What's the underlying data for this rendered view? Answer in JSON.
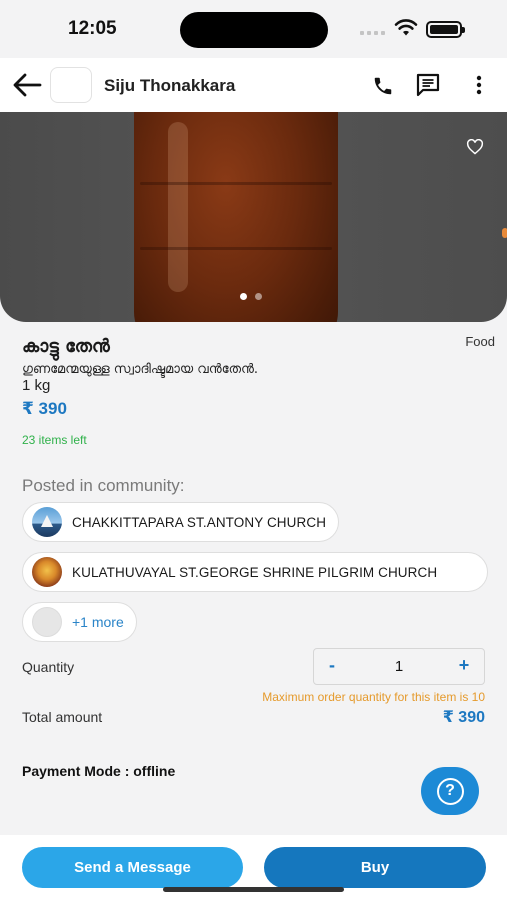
{
  "status_bar": {
    "time": "12:05"
  },
  "header": {
    "title": "Siju Thonakkara"
  },
  "gallery": {
    "image_count": 2,
    "active_index": 0
  },
  "product": {
    "title": "കാട്ടു തേൻ",
    "category": "Food",
    "description": "ഗുണമേന്മയുള്ള സ്വാദിഷ്ടമായ വൻതേൻ.",
    "weight": "1 kg",
    "price": "₹ 390",
    "stock": "23 items left"
  },
  "community": {
    "label": "Posted in community:",
    "items": [
      {
        "name": "CHAKKITTAPARA ST.ANTONY CHURCH"
      },
      {
        "name": "KULATHUVAYAL ST.GEORGE SHRINE PILGRIM CHURCH"
      }
    ],
    "more": "+1 more"
  },
  "order": {
    "quantity_label": "Quantity",
    "minus": "-",
    "quantity": "1",
    "plus": "+",
    "max_note": "Maximum order quantity for this item is 10",
    "total_label": "Total amount",
    "total_value": "₹ 390",
    "payment_mode": "Payment Mode : offline"
  },
  "help": {
    "label": "?"
  },
  "actions": {
    "message": "Send a Message",
    "buy": "Buy"
  },
  "colors": {
    "accent": "#1d78c1",
    "stock_green": "#2fb14a",
    "note_orange": "#e59a2c",
    "message_btn": "#2ba6e8",
    "buy_btn": "#1577be"
  }
}
